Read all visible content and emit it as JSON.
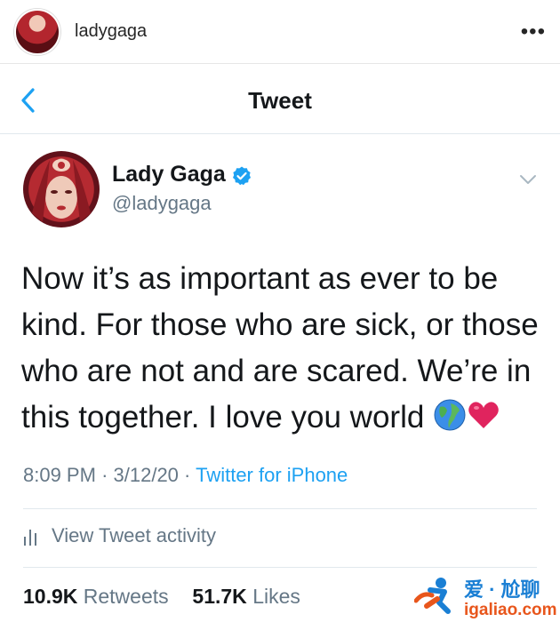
{
  "instagram_header": {
    "username": "ladygaga",
    "more_icon": "ellipsis-icon",
    "more_label": "•••"
  },
  "twitter_nav": {
    "back_icon": "chevron-left-icon",
    "title": "Tweet"
  },
  "tweet": {
    "display_name": "Lady Gaga",
    "handle": "@ladygaga",
    "verified_icon": "verified-badge-icon",
    "text": "Now it’s as important as ever to be kind. For those who are sick, or those who are not and are scared. We’re in this together. I love you world",
    "emojis": [
      "globe-icon",
      "heart-icon"
    ],
    "time": "8:09 PM",
    "date": "3/12/20",
    "source": "Twitter for iPhone",
    "separator": "·",
    "activity_label": "View Tweet activity",
    "retweets_count": "10.9K",
    "retweets_label": "Retweets",
    "likes_count": "51.7K",
    "likes_label": "Likes"
  },
  "watermark": {
    "title": "爱 · 尬聊",
    "url": "igaliao.com"
  },
  "colors": {
    "twitter_blue": "#1da1f2",
    "secondary_text": "#657786",
    "primary_text": "#14171a",
    "heart_red": "#e0245e"
  }
}
